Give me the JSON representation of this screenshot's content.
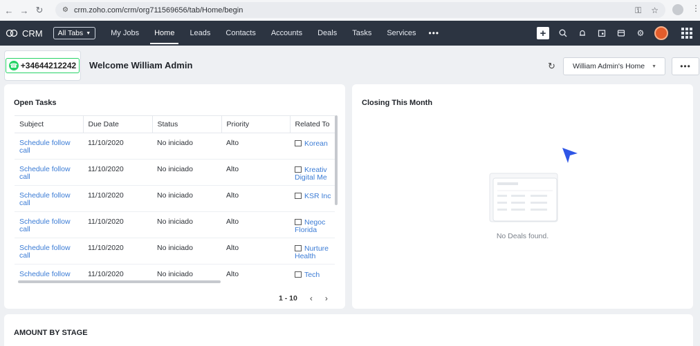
{
  "browser": {
    "url": "crm.zoho.com/crm/org711569656/tab/Home/begin"
  },
  "topnav": {
    "brand": "CRM",
    "all_tabs": "All Tabs",
    "tabs": [
      {
        "label": "My Jobs"
      },
      {
        "label": "Home"
      },
      {
        "label": "Leads"
      },
      {
        "label": "Contacts"
      },
      {
        "label": "Accounts"
      },
      {
        "label": "Deals"
      },
      {
        "label": "Tasks"
      },
      {
        "label": "Services"
      }
    ],
    "active_tab": "Home",
    "more": "•••"
  },
  "header": {
    "whatsapp_number": "+34644212242",
    "welcome": "Welcome William Admin",
    "home_select": "William Admin's Home",
    "more": "•••"
  },
  "open_tasks": {
    "title": "Open Tasks",
    "columns": [
      "Subject",
      "Due Date",
      "Status",
      "Priority",
      "Related To"
    ],
    "rows": [
      {
        "subject": "Schedule follow call",
        "due": "11/10/2020",
        "status": "No iniciado",
        "priority": "Alto",
        "related": "Korean"
      },
      {
        "subject": "Schedule follow call",
        "due": "11/10/2020",
        "status": "No iniciado",
        "priority": "Alto",
        "related": "Kreativ Digital Me"
      },
      {
        "subject": "Schedule follow call",
        "due": "11/10/2020",
        "status": "No iniciado",
        "priority": "Alto",
        "related": "KSR Inc"
      },
      {
        "subject": "Schedule follow call",
        "due": "11/10/2020",
        "status": "No iniciado",
        "priority": "Alto",
        "related": "Negoc Florida"
      },
      {
        "subject": "Schedule follow call",
        "due": "11/10/2020",
        "status": "No iniciado",
        "priority": "Alto",
        "related": "Nurture Health"
      },
      {
        "subject": "Schedule follow",
        "due": "11/10/2020",
        "status": "No iniciado",
        "priority": "Alto",
        "related": "Tech"
      }
    ],
    "pager": "1 - 10"
  },
  "closing": {
    "title": "Closing This Month",
    "empty_text": "No Deals found."
  },
  "amount_by_stage": {
    "title": "AMOUNT BY STAGE"
  }
}
